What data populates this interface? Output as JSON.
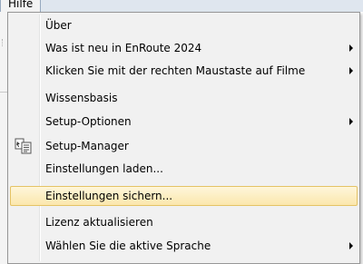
{
  "menubar": {
    "title": "Hilfe"
  },
  "menu": {
    "items": [
      {
        "label": "Über",
        "has_submenu": false
      },
      {
        "label": "Was ist neu in EnRoute 2024",
        "has_submenu": true
      },
      {
        "label": "Klicken Sie mit der rechten Maustaste auf Filme",
        "has_submenu": true
      },
      {
        "label": "Wissensbasis",
        "has_submenu": false
      },
      {
        "label": "Setup-Optionen",
        "has_submenu": true
      },
      {
        "label": "Setup-Manager",
        "has_submenu": false,
        "icon": "setup-manager-icon"
      },
      {
        "label": "Einstellungen laden...",
        "has_submenu": false
      },
      {
        "label": "Einstellungen sichern...",
        "has_submenu": false,
        "highlighted": true
      },
      {
        "label": "Lizenz aktualisieren",
        "has_submenu": false
      },
      {
        "label": "Wählen Sie die aktive Sprache",
        "has_submenu": true
      }
    ]
  },
  "colors": {
    "menu_background": "#f1f1f1",
    "highlight_background": "#fbe7ad",
    "highlight_border": "#e5c365"
  }
}
